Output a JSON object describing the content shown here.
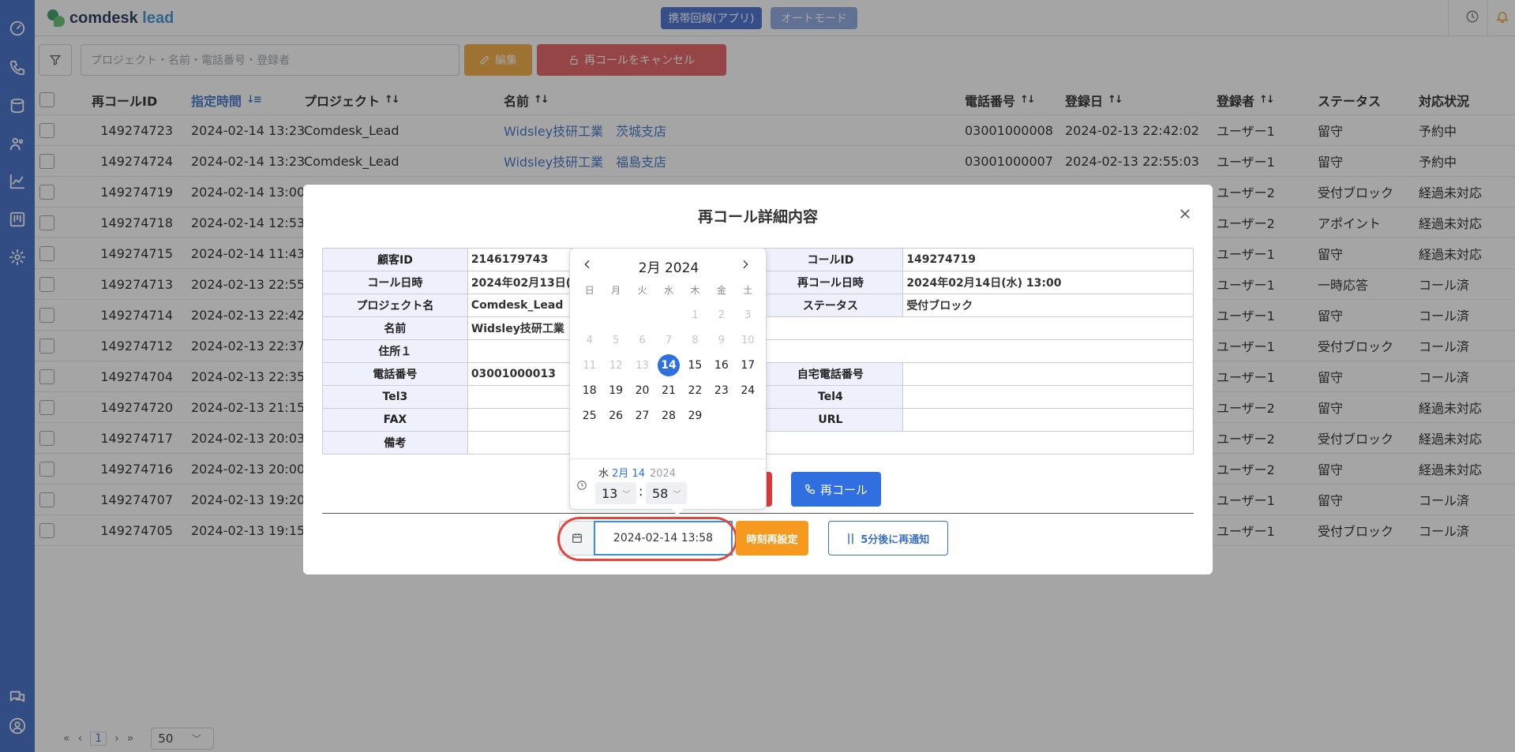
{
  "brand": {
    "main": "comdesk",
    "accent": "lead"
  },
  "header": {
    "mode_app": "携帯回線(アプリ)",
    "mode_auto": "オートモード"
  },
  "toolbar": {
    "search_placeholder": "プロジェクト・名前・電話番号・登録者",
    "edit_label": "編集",
    "cancel_label": "再コールをキャンセル"
  },
  "table": {
    "headers": {
      "id": "再コールID",
      "time": "指定時間",
      "project": "プロジェクト",
      "name": "名前",
      "tel": "電話番号",
      "registered": "登録日",
      "user": "登録者",
      "status": "ステータス",
      "state": "対応状況"
    },
    "rows": [
      {
        "id": "149274723",
        "time": "2024-02-14 13:23",
        "project": "Comdesk_Lead",
        "name": "Widsley技研工業　茨城支店",
        "tel": "03001000008",
        "registered": "2024-02-13 22:42:02",
        "user": "ユーザー1",
        "status": "留守",
        "state": "予約中"
      },
      {
        "id": "149274724",
        "time": "2024-02-14 13:23",
        "project": "Comdesk_Lead",
        "name": "Widsley技研工業　福島支店",
        "tel": "03001000007",
        "registered": "2024-02-13 22:55:03",
        "user": "ユーザー1",
        "status": "留守",
        "state": "予約中"
      },
      {
        "id": "149274719",
        "time": "2024-02-14 13:00",
        "user": "ユーザー2",
        "status": "受付ブロック",
        "state": "経過未対応"
      },
      {
        "id": "149274718",
        "time": "2024-02-14 12:53",
        "user": "ユーザー2",
        "status": "アポイント",
        "state": "経過未対応"
      },
      {
        "id": "149274715",
        "time": "2024-02-14 11:43",
        "user": "ユーザー1",
        "status": "留守",
        "state": "経過未対応"
      },
      {
        "id": "149274713",
        "time": "2024-02-13 22:55",
        "user": "ユーザー1",
        "status": "一時応答",
        "state": "コール済"
      },
      {
        "id": "149274714",
        "time": "2024-02-13 22:42",
        "user": "ユーザー1",
        "status": "留守",
        "state": "コール済"
      },
      {
        "id": "149274712",
        "time": "2024-02-13 22:37",
        "user": "ユーザー1",
        "status": "受付ブロック",
        "state": "コール済"
      },
      {
        "id": "149274704",
        "time": "2024-02-13 22:35",
        "user": "ユーザー1",
        "status": "留守",
        "state": "コール済"
      },
      {
        "id": "149274720",
        "time": "2024-02-13 21:15",
        "user": "ユーザー2",
        "status": "留守",
        "state": "経過未対応"
      },
      {
        "id": "149274717",
        "time": "2024-02-13 20:03",
        "user": "ユーザー2",
        "status": "受付ブロック",
        "state": "経過未対応"
      },
      {
        "id": "149274716",
        "time": "2024-02-13 20:00",
        "user": "ユーザー2",
        "status": "留守",
        "state": "経過未対応"
      },
      {
        "id": "149274707",
        "time": "2024-02-13 19:20",
        "user": "ユーザー1",
        "status": "留守",
        "state": "コール済"
      },
      {
        "id": "149274705",
        "time": "2024-02-13 19:15",
        "user": "ユーザー1",
        "status": "受付ブロック",
        "state": "コール済"
      }
    ]
  },
  "pager": {
    "current": "1",
    "page_size": "50"
  },
  "modal": {
    "title": "再コール詳細内容",
    "fields": {
      "customer_id_k": "顧客ID",
      "customer_id_v": "2146179743",
      "call_id_k": "コールID",
      "call_id_v": "149274719",
      "call_dt_k": "コール日時",
      "call_dt_v": "2024年02月13日(火",
      "recall_dt_k": "再コール日時",
      "recall_dt_v": "2024年02月14日(水) 13:00",
      "project_k": "プロジェクト名",
      "project_v": "Comdesk_Lead",
      "status_k": "ステータス",
      "status_v": "受付ブロック",
      "name_k": "名前",
      "name_v": "Widsley技研工業",
      "address_k": "住所１",
      "tel_k": "電話番号",
      "tel_v": "03001000013",
      "home_tel_k": "自宅電話番号",
      "tel3_k": "Tel3",
      "tel4_k": "Tel4",
      "fax_k": "FAX",
      "url_k": "URL",
      "note_k": "備考"
    },
    "recall_label": "再コール",
    "datetime_value": "2024-02-14 13:58",
    "reset_label": "時刻再設定",
    "snooze_label": "5分後に再通知"
  },
  "picker": {
    "month_label": "2月 2024",
    "weekdays": [
      "日",
      "月",
      "火",
      "水",
      "木",
      "金",
      "土"
    ],
    "weeks": [
      [
        null,
        null,
        null,
        null,
        "1",
        "2",
        "3"
      ],
      [
        "4",
        "5",
        "6",
        "7",
        "8",
        "9",
        "10"
      ],
      [
        "11",
        "12",
        "13",
        "14",
        "15",
        "16",
        "17"
      ],
      [
        "18",
        "19",
        "20",
        "21",
        "22",
        "23",
        "24"
      ],
      [
        "25",
        "26",
        "27",
        "28",
        "29",
        null,
        null
      ]
    ],
    "selected_day": "14",
    "footer_weekday": "水",
    "footer_month_day": "2月 14",
    "footer_year": "2024",
    "hour": "13",
    "minute": "58"
  },
  "colors": {
    "primary": "#2f6fe0",
    "rail": "#3a66c7",
    "danger": "#e23838",
    "warning": "#f59a1f",
    "highlight": "#e1473a"
  }
}
